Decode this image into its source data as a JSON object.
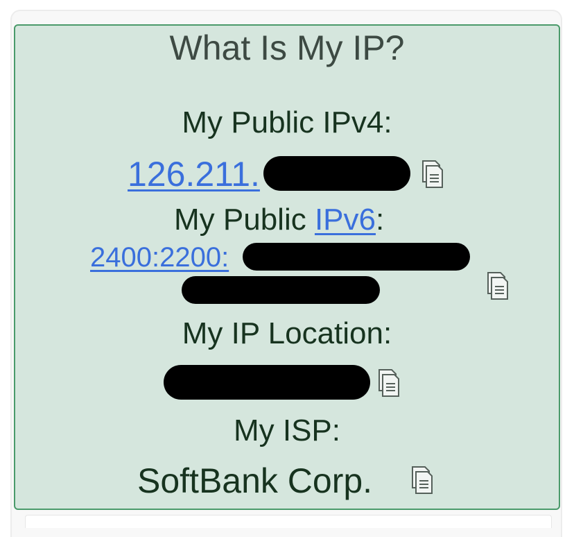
{
  "title": "What Is My IP?",
  "ipv4": {
    "label": "My Public IPv4:",
    "value_visible": "126.211."
  },
  "ipv6": {
    "label_prefix": "My Public ",
    "label_link": "IPv6",
    "label_suffix": ":",
    "value_visible": "2400:2200:"
  },
  "location": {
    "label": "My IP Location:"
  },
  "isp": {
    "label": "My ISP:",
    "value": "SoftBank Corp."
  },
  "icons": {
    "copy": "copy-icon",
    "redaction": "redaction-bar"
  },
  "colors": {
    "panel_bg": "#d5e6dd",
    "panel_border": "#4a9a6a",
    "text": "#17331f",
    "link": "#3a6fdc",
    "redaction": "#000000"
  }
}
